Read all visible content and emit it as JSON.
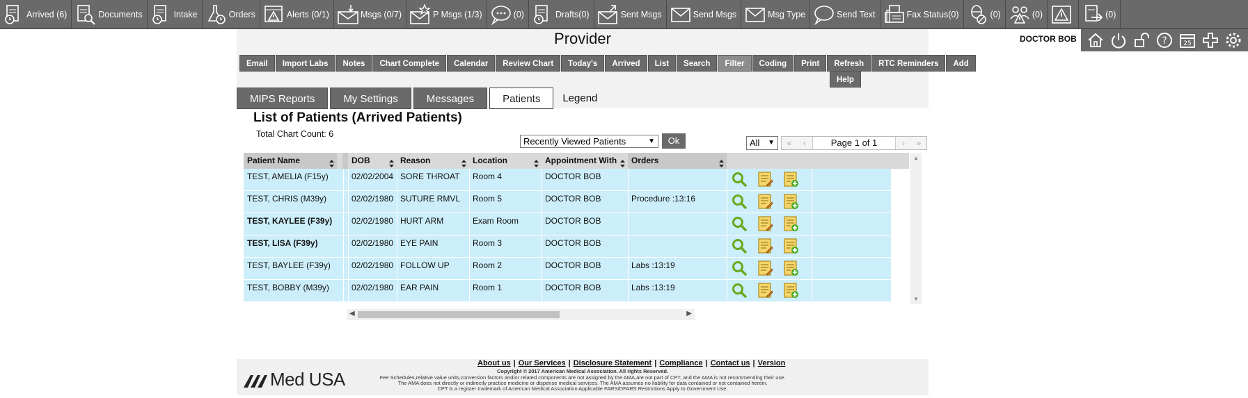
{
  "toolbar": {
    "items": [
      {
        "icon": "arrived-icon",
        "label": "Arrived (6)"
      },
      {
        "icon": "documents-icon",
        "label": "Documents"
      },
      {
        "icon": "intake-icon",
        "label": "Intake"
      },
      {
        "icon": "orders-icon",
        "label": "Orders"
      },
      {
        "icon": "alerts-icon",
        "label": "Alerts (0/1)"
      },
      {
        "icon": "msgs-icon",
        "label": "Msgs (0/7)"
      },
      {
        "icon": "priority-msgs-icon",
        "label": "P Msgs (1/3)"
      },
      {
        "icon": "chat-icon",
        "label": "(0)"
      },
      {
        "icon": "drafts-icon",
        "label": "Drafts(0)"
      },
      {
        "icon": "sent-msgs-icon",
        "label": "Sent Msgs"
      },
      {
        "icon": "send-msgs-icon",
        "label": "Send Msgs"
      },
      {
        "icon": "msg-type-icon",
        "label": "Msg Type"
      },
      {
        "icon": "send-text-icon",
        "label": "Send Text"
      },
      {
        "icon": "fax-icon",
        "label": "Fax Status(0)"
      },
      {
        "icon": "pill-icon",
        "label": "(0)"
      },
      {
        "icon": "people-alert-icon",
        "label": "(0)"
      },
      {
        "icon": "warning-icon",
        "label": ""
      },
      {
        "icon": "export-icon",
        "label": "(0)"
      }
    ]
  },
  "header": {
    "title": "Provider",
    "user_name": "DOCTOR BOB"
  },
  "nav": {
    "row1": [
      "Email",
      "Import Labs",
      "Notes",
      "Chart Complete",
      "Calendar",
      "Review Chart",
      "Today's",
      "Arrived",
      "List",
      "Search",
      "Filter",
      "Coding",
      "Print",
      "Refresh",
      "RTC Reminders",
      "Add"
    ],
    "row2": [
      "Help"
    ]
  },
  "tabs": {
    "items": [
      "MIPS Reports",
      "My Settings",
      "Messages",
      "Patients"
    ],
    "selected": "Patients",
    "legend": "Legend"
  },
  "list": {
    "title": "List of Patients  (Arrived Patients)",
    "total_count": "Total Chart Count: 6",
    "filter_value": "Recently Viewed Patients",
    "ok_label": "Ok",
    "page_size": "All",
    "page_info": "Page 1 of 1"
  },
  "table": {
    "columns": [
      "Patient Name",
      "DOB",
      "Reason",
      "Location",
      "Appointment With",
      "Orders"
    ],
    "rows": [
      {
        "name": "TEST, AMELIA (F15y)",
        "dob": "02/02/2004",
        "reason": "SORE THROAT",
        "location": "Room 4",
        "appt": "DOCTOR BOB",
        "orders": "",
        "bold": false
      },
      {
        "name": "TEST, CHRIS (M39y)",
        "dob": "02/02/1980",
        "reason": "SUTURE RMVL",
        "location": "Room 5",
        "appt": "DOCTOR BOB",
        "orders": "Procedure :13:16",
        "bold": false
      },
      {
        "name": "TEST, KAYLEE (F39y)",
        "dob": "02/02/1980",
        "reason": "HURT ARM",
        "location": "Exam Room",
        "appt": "DOCTOR BOB",
        "orders": "",
        "bold": true
      },
      {
        "name": "TEST, LISA (F39y)",
        "dob": "02/02/1980",
        "reason": "EYE PAIN",
        "location": "Room 3",
        "appt": "DOCTOR BOB",
        "orders": "",
        "bold": true
      },
      {
        "name": "TEST, BAYLEE (F39y)",
        "dob": "02/02/1980",
        "reason": "FOLLOW UP",
        "location": "Room 2",
        "appt": "DOCTOR BOB",
        "orders": "Labs :13:19",
        "bold": false
      },
      {
        "name": "TEST, BOBBY (M39y)",
        "dob": "02/02/1980",
        "reason": "EAR PAIN",
        "location": "Room 1",
        "appt": "DOCTOR BOB",
        "orders": "Labs :13:19",
        "bold": false
      }
    ]
  },
  "footer": {
    "links": [
      "About us",
      "Our Services",
      "Disclosure Statement",
      "Compliance",
      "Contact us",
      "Version"
    ],
    "copyright": "Copyright © 2017 American Medical Association. All rights Reserved.",
    "legal1": "Fee Schedules,relative value units,conversion factors and/or related components are not assigned by the AMA,are not part of CPT, and the AMA is not recommending their use.",
    "legal2": "The AMA does not directly or indirectly practice medicine or dispense medical services. The AMA assumes no liability for data contained or not contained herein.",
    "legal3": "CPT is a register trademark of American Medical Association  Applicable FARS/DFARS Restrictions Apply to Government Use.",
    "logo_text": "Med USA"
  },
  "colors": {
    "toolbar_bg": "#6a6a6a",
    "row_bg": "#cceefa",
    "header_bg": "#d9d9d9"
  }
}
